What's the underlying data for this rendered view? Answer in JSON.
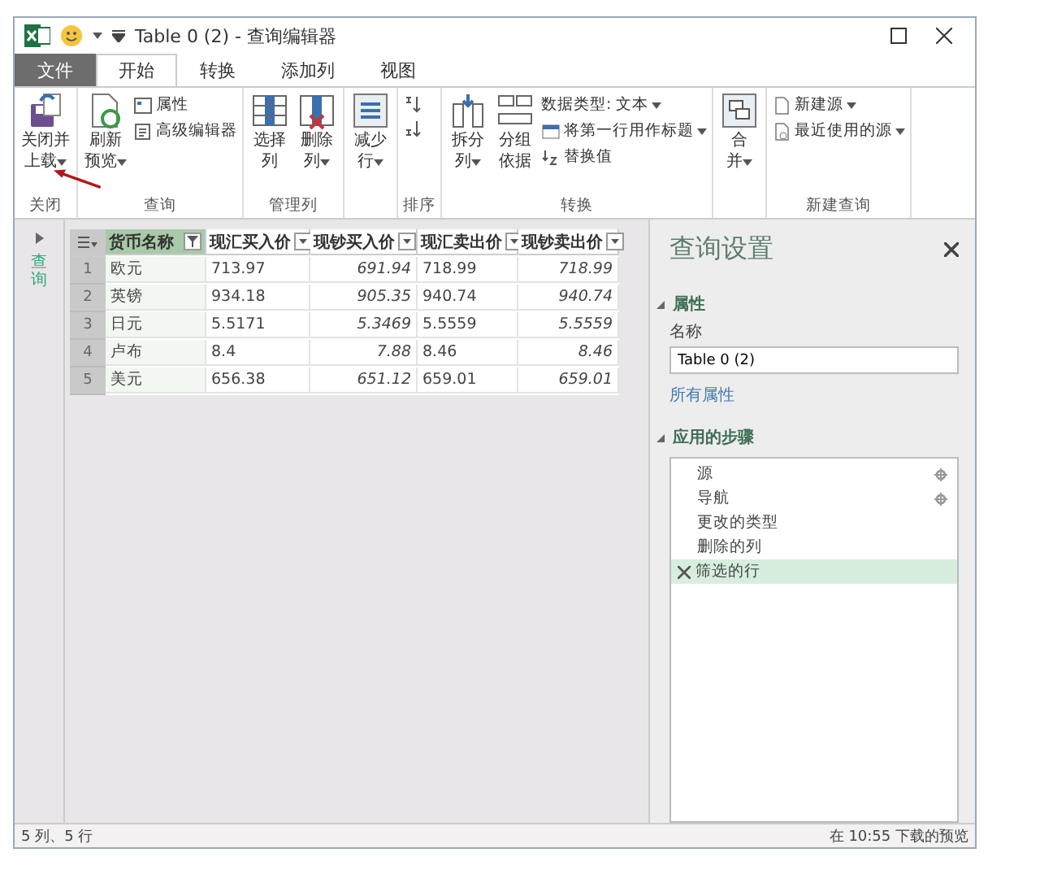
{
  "window": {
    "title": "Table 0 (2) - 查询编辑器"
  },
  "tabs": [
    {
      "label": "文件",
      "kind": "file",
      "selected": false
    },
    {
      "label": "开始",
      "kind": "tab",
      "selected": true
    },
    {
      "label": "转换",
      "kind": "tab",
      "selected": false
    },
    {
      "label": "添加列",
      "kind": "tab",
      "selected": false
    },
    {
      "label": "视图",
      "kind": "tab",
      "selected": false
    }
  ],
  "ribbon": {
    "groups": [
      {
        "label": "关闭",
        "buttons": [
          {
            "kind": "large",
            "lines": [
              "关闭并",
              "上载"
            ],
            "dropdown": true
          }
        ]
      },
      {
        "label": "查询",
        "buttons": [
          {
            "kind": "large",
            "lines": [
              "刷新",
              "预览"
            ],
            "dropdown": true
          },
          {
            "kind": "small",
            "label": "属性",
            "dropdown": false
          },
          {
            "kind": "small",
            "label": "高级编辑器",
            "dropdown": false
          }
        ]
      },
      {
        "label": "管理列",
        "buttons": [
          {
            "kind": "large",
            "lines": [
              "选择",
              "列"
            ],
            "dropdown": false
          },
          {
            "kind": "large",
            "lines": [
              "删除",
              "列"
            ],
            "dropdown": true
          }
        ]
      },
      {
        "buttons": [
          {
            "kind": "large",
            "lines": [
              "减少",
              "行"
            ],
            "dropdown": true
          }
        ]
      },
      {
        "label": "排序",
        "buttons": [
          {
            "kind": "small"
          },
          {
            "kind": "small"
          }
        ]
      },
      {
        "label": "转换",
        "buttons": [
          {
            "kind": "large",
            "lines": [
              "拆分",
              "列"
            ],
            "dropdown": true
          },
          {
            "kind": "large",
            "lines": [
              "分组",
              "依据"
            ],
            "dropdown": false
          },
          {
            "kind": "small",
            "label": "数据类型: 文本",
            "dropdown": true
          },
          {
            "kind": "small",
            "label": "将第一行用作标题",
            "dropdown": true
          },
          {
            "kind": "small",
            "label": "替换值",
            "dropdown": false
          }
        ]
      },
      {
        "buttons": [
          {
            "kind": "large",
            "lines": [
              "合",
              "并"
            ],
            "dropdown": true
          }
        ]
      },
      {
        "label": "新建查询",
        "buttons": [
          {
            "kind": "small",
            "label": "新建源",
            "dropdown": true
          },
          {
            "kind": "small",
            "label": "最近使用的源",
            "dropdown": true
          }
        ]
      }
    ]
  },
  "queries_pane": {
    "label": "查询",
    "expanded": false
  },
  "table": {
    "columns": [
      {
        "name": "货币名称",
        "kind": "text",
        "selected": true
      },
      {
        "name": "现汇买入价",
        "kind": "text",
        "selected": false
      },
      {
        "name": "现钞买入价",
        "kind": "number",
        "selected": false
      },
      {
        "name": "现汇卖出价",
        "kind": "text",
        "selected": false
      },
      {
        "name": "现钞卖出价",
        "kind": "number",
        "selected": false
      }
    ],
    "rows": [
      {
        "index": "1",
        "cells": [
          "欧元",
          "713.97",
          "691.94",
          "718.99",
          "718.99"
        ]
      },
      {
        "index": "2",
        "cells": [
          "英镑",
          "934.18",
          "905.35",
          "940.74",
          "940.74"
        ]
      },
      {
        "index": "3",
        "cells": [
          "日元",
          "5.5171",
          "5.3469",
          "5.5559",
          "5.5559"
        ]
      },
      {
        "index": "4",
        "cells": [
          "卢布",
          "8.4",
          "7.88",
          "8.46",
          "8.46"
        ]
      },
      {
        "index": "5",
        "cells": [
          "美元",
          "656.38",
          "651.12",
          "659.01",
          "659.01"
        ]
      }
    ]
  },
  "settings": {
    "title": "查询设置",
    "properties": {
      "label": "属性",
      "expanded": true,
      "name_label": "名称",
      "name_value": "Table 0 (2)",
      "link": "所有属性"
    },
    "steps": {
      "label": "应用的步骤",
      "expanded": true,
      "items": [
        {
          "label": "源",
          "has_settings": true,
          "selected": false
        },
        {
          "label": "导航",
          "has_settings": true,
          "selected": false
        },
        {
          "label": "更改的类型",
          "has_settings": false,
          "selected": false
        },
        {
          "label": "删除的列",
          "has_settings": false,
          "selected": false
        },
        {
          "label": "筛选的行",
          "has_settings": false,
          "selected": true
        }
      ]
    }
  },
  "status_bar": {
    "left": "5 列、5 行",
    "right": "在 10:55 下载的预览"
  }
}
